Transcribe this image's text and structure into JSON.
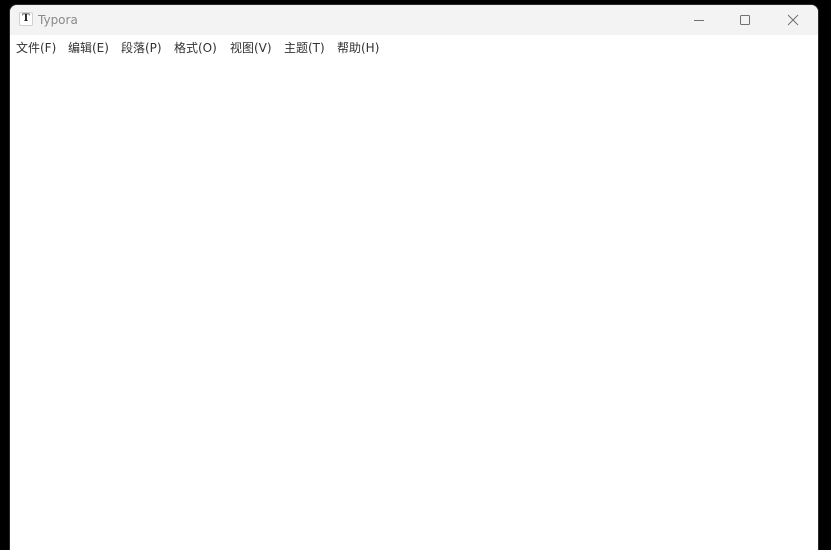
{
  "window": {
    "title": "Typora",
    "app_icon_letter": "T"
  },
  "titlebar_buttons": {
    "minimize_icon": "minimize-icon",
    "maximize_icon": "maximize-icon",
    "close_icon": "close-icon"
  },
  "menu": {
    "items": [
      {
        "label": "文件(F)"
      },
      {
        "label": "编辑(E)"
      },
      {
        "label": "段落(P)"
      },
      {
        "label": "格式(O)"
      },
      {
        "label": "视图(V)"
      },
      {
        "label": "主题(T)"
      },
      {
        "label": "帮助(H)"
      }
    ]
  },
  "colors": {
    "titlebar_bg": "#f3f3f3",
    "window_bg": "#ffffff",
    "desktop_bg": "#000000",
    "menu_text": "#333333",
    "title_text": "#8a8a8a"
  }
}
